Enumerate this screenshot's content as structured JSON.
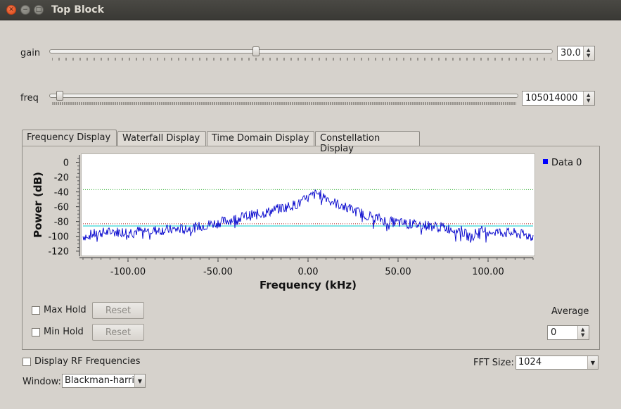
{
  "window": {
    "title": "Top Block"
  },
  "controls": {
    "gain": {
      "label": "gain",
      "value": "30.0",
      "fraction": 0.41
    },
    "freq": {
      "label": "freq",
      "value": "105014000",
      "fraction": 0.01
    }
  },
  "tabs": [
    {
      "label": "Frequency Display",
      "active": true
    },
    {
      "label": "Waterfall Display",
      "active": false
    },
    {
      "label": "Time Domain Display",
      "active": false
    },
    {
      "label": "Constellation Display",
      "active": false
    }
  ],
  "chart_data": {
    "type": "line",
    "xlabel": "Frequency (kHz)",
    "ylabel": "Power (dB)",
    "xlim": [
      -125,
      125
    ],
    "ylim": [
      -125,
      10
    ],
    "x_ticks": [
      "-100.00",
      "-50.00",
      "0.00",
      "50.00",
      "100.00"
    ],
    "y_ticks": [
      "0",
      "-20",
      "-40",
      "-60",
      "-80",
      "-100",
      "-120"
    ],
    "legend": "top-right",
    "series": [
      {
        "name": "Data 0",
        "color": "#0000cc",
        "x": [
          -125,
          -115,
          -105,
          -95,
          -85,
          -75,
          -65,
          -55,
          -45,
          -35,
          -25,
          -15,
          -5,
          0,
          5,
          10,
          15,
          25,
          35,
          45,
          55,
          65,
          75,
          85,
          90,
          95,
          105,
          115,
          125
        ],
        "values": [
          -100,
          -95,
          -94,
          -93,
          -92,
          -91,
          -89,
          -84,
          -79,
          -73,
          -69,
          -62,
          -56,
          -48,
          -42,
          -47,
          -55,
          -65,
          -73,
          -80,
          -83,
          -85,
          -88,
          -92,
          -102,
          -92,
          -94,
          -96,
          -100
        ]
      }
    ],
    "reference_lines": [
      {
        "y": -37,
        "color": "#22aa22",
        "style": "dotted"
      },
      {
        "y": -83,
        "color": "#aa2222",
        "style": "dotted"
      },
      {
        "y": -86,
        "color": "#00cccc",
        "style": "solid"
      }
    ]
  },
  "panel_controls": {
    "max_hold_label": "Max Hold",
    "min_hold_label": "Min Hold",
    "reset_label": "Reset",
    "average_label": "Average",
    "average_value": "0"
  },
  "bottom": {
    "display_rf_label": "Display RF Frequencies",
    "fft_size_label": "FFT Size:",
    "fft_size_value": "1024",
    "window_label": "Window:",
    "window_value": "Blackman-harris"
  }
}
